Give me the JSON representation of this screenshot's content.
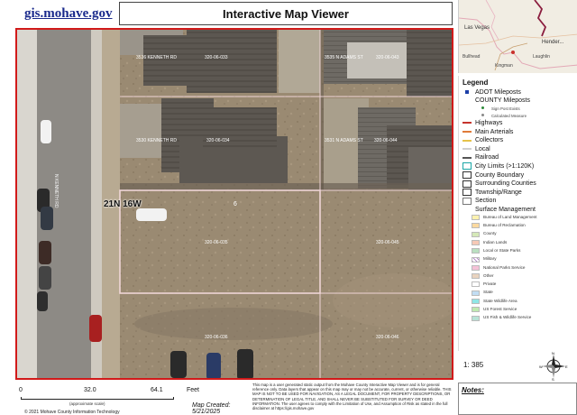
{
  "header": {
    "site_url": "gis.mohave.gov",
    "title": "Interactive Map Viewer"
  },
  "inset_map": {
    "places": [
      "Las Vegas",
      "Hender...",
      "Bullhead",
      "Laughlin",
      "Kingman"
    ]
  },
  "map": {
    "parcels": [
      {
        "address": "3536 KENNETH RD",
        "apn": "320-06-033"
      },
      {
        "address": "3535 N ADAMS ST",
        "apn": "320-06-043"
      },
      {
        "address": "3530 KENNETH RD",
        "apn": "320-06-034"
      },
      {
        "address": "3531 N ADAMS ST",
        "apn": "320-06-044"
      },
      {
        "address": "",
        "apn": "320-06-035"
      },
      {
        "address": "",
        "apn": "320-06-045"
      },
      {
        "address": "",
        "apn": "320-06-036"
      },
      {
        "address": "",
        "apn": "320-06-046"
      }
    ],
    "section_label": "21N 16W",
    "section_number": "6",
    "street_label": "N KENNETH RD",
    "colors": {
      "parcel_outline": "#f4d9dc",
      "map_border": "#d11a1a"
    }
  },
  "legend": {
    "title": "Legend",
    "items": [
      {
        "label": "ADOT Mileposts",
        "level": 0,
        "symbol": "square",
        "color": "#1c3fa8"
      },
      {
        "label": "COUNTY Mileposts",
        "level": 0,
        "symbol": "none",
        "color": ""
      },
      {
        "label": "Sign Post Exists",
        "level": 2,
        "symbol": "dot",
        "color": "#2e8b3a"
      },
      {
        "label": "Calculated Measure",
        "level": 2,
        "symbol": "dot",
        "color": "#888888"
      },
      {
        "label": "Highways",
        "level": 0,
        "symbol": "line",
        "color": "#c6342d"
      },
      {
        "label": "Main Arterials",
        "level": 0,
        "symbol": "line",
        "color": "#e07b39"
      },
      {
        "label": "Collectors",
        "level": 0,
        "symbol": "line",
        "color": "#e6c34a"
      },
      {
        "label": "Local",
        "level": 0,
        "symbol": "line",
        "color": "#cfcfcf"
      },
      {
        "label": "Railroad",
        "level": 0,
        "symbol": "line",
        "color": "#555555"
      },
      {
        "label": "City Limits (>1:120K)",
        "level": 0,
        "symbol": "box",
        "color": "#1aa6a6"
      },
      {
        "label": "County Boundary",
        "level": 0,
        "symbol": "box",
        "color": "#333333"
      },
      {
        "label": "Surrounding Counties",
        "level": 0,
        "symbol": "box",
        "color": "#333333"
      },
      {
        "label": "Township/Range",
        "level": 0,
        "symbol": "box",
        "color": "#333333"
      },
      {
        "label": "Section",
        "level": 0,
        "symbol": "box",
        "color": "#777777"
      },
      {
        "label": "Surface Management",
        "level": 0,
        "symbol": "none",
        "color": ""
      },
      {
        "label": "Bureau of Land Management",
        "level": 1,
        "symbol": "fill",
        "color": "#fdf2b0"
      },
      {
        "label": "Bureau of Reclamation",
        "level": 1,
        "symbol": "fill",
        "color": "#fbd9a0"
      },
      {
        "label": "County",
        "level": 1,
        "symbol": "fill",
        "color": "#d5e8b8"
      },
      {
        "label": "Indian Lands",
        "level": 1,
        "symbol": "fill",
        "color": "#f6c9b6"
      },
      {
        "label": "Local or State Parks",
        "level": 1,
        "symbol": "fill",
        "color": "#b9dfc0"
      },
      {
        "label": "Military",
        "level": 1,
        "symbol": "hatch",
        "color": "#b58bc8"
      },
      {
        "label": "National Parks Service",
        "level": 1,
        "symbol": "fill",
        "color": "#f4c2d7"
      },
      {
        "label": "Other",
        "level": 1,
        "symbol": "fill",
        "color": "#e9d3bf"
      },
      {
        "label": "Private",
        "level": 1,
        "symbol": "fill",
        "color": "#ffffff"
      },
      {
        "label": "State",
        "level": 1,
        "symbol": "fill",
        "color": "#c2ddf3"
      },
      {
        "label": "State Wildlife Area",
        "level": 1,
        "symbol": "fill",
        "color": "#8fe6e6"
      },
      {
        "label": "US Forest Service",
        "level": 1,
        "symbol": "fill",
        "color": "#bfe9b0"
      },
      {
        "label": "US Fish & Wildlife Service",
        "level": 1,
        "symbol": "fill",
        "color": "#b7e3d6"
      }
    ]
  },
  "scale": {
    "ratio": "1: 385",
    "bar_ticks": [
      "0",
      "32.0",
      "64.1"
    ],
    "bar_units": "Feet",
    "approx_note": "(approximate scale)"
  },
  "compass": {
    "north": "N",
    "south": "S",
    "east": "E",
    "west": "W"
  },
  "footer": {
    "copyright": "© 2021 Mohave County Information Technology",
    "created": "Map Created: 5/21/2025",
    "disclaimer": "This map is a user generated static output from the Mohave County Interactive Map Viewer and is for general reference only. Data layers that appear on this map may or may not be accurate, current, or otherwise reliable. THIS MAP IS NOT TO BE USED FOR NAVIGATION, AS A LEGAL DOCUMENT, FOR PROPERTY DESCRIPTIONS, OR DETERMINATION OF LEGAL TITLE, AND SHALL NEVER BE SUBSTITUTED FOR SURVEY OR DEED INFORMATION. The user agrees to comply with the Limitation of Use, and Assumption of Risk as stated in the full disclaimer at https://gis.mohave.gov",
    "notes_label": "Notes:"
  }
}
